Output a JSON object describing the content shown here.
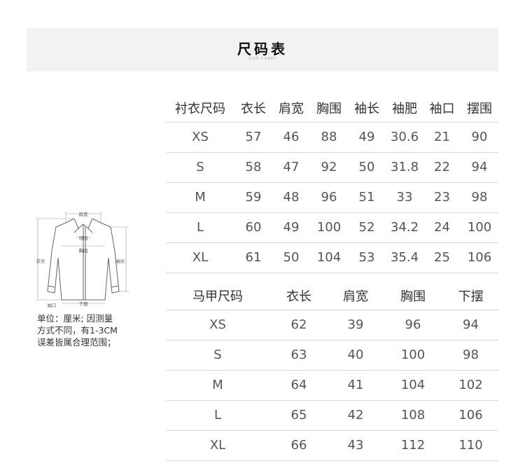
{
  "header": {
    "title": "尺码表",
    "subtitle": "SIZE CHART"
  },
  "shirt_table": {
    "headers": [
      "衬衣尺码",
      "衣长",
      "肩宽",
      "胸围",
      "袖长",
      "袖肥",
      "袖口",
      "摆围"
    ],
    "rows": [
      [
        "XS",
        "57",
        "46",
        "88",
        "49",
        "30.6",
        "21",
        "90"
      ],
      [
        "S",
        "58",
        "47",
        "92",
        "50",
        "31.8",
        "22",
        "94"
      ],
      [
        "M",
        "59",
        "48",
        "96",
        "51",
        "33",
        "23",
        "98"
      ],
      [
        "L",
        "60",
        "49",
        "100",
        "52",
        "34.2",
        "24",
        "100"
      ],
      [
        "XL",
        "61",
        "50",
        "104",
        "53",
        "35.4",
        "25",
        "106"
      ]
    ]
  },
  "vest_table": {
    "headers": [
      "马甲尺码",
      "衣长",
      "肩宽",
      "胸围",
      "下摆"
    ],
    "rows": [
      [
        "XS",
        "62",
        "39",
        "96",
        "94"
      ],
      [
        "S",
        "63",
        "40",
        "100",
        "98"
      ],
      [
        "M",
        "64",
        "41",
        "104",
        "102"
      ],
      [
        "L",
        "65",
        "42",
        "108",
        "106"
      ],
      [
        "XL",
        "66",
        "43",
        "112",
        "110"
      ]
    ]
  },
  "diagram": {
    "labels": {
      "shoulder": "肩宽",
      "neck": "领围",
      "chest": "胸围",
      "length": "衣长",
      "sleeve": "袖长",
      "hem": "下摆",
      "cuff": "袖口"
    }
  },
  "note": {
    "lines": [
      "单位：厘米; 因测量",
      "方式不同，有1-3CM",
      "误差皆属合理范围；"
    ]
  }
}
